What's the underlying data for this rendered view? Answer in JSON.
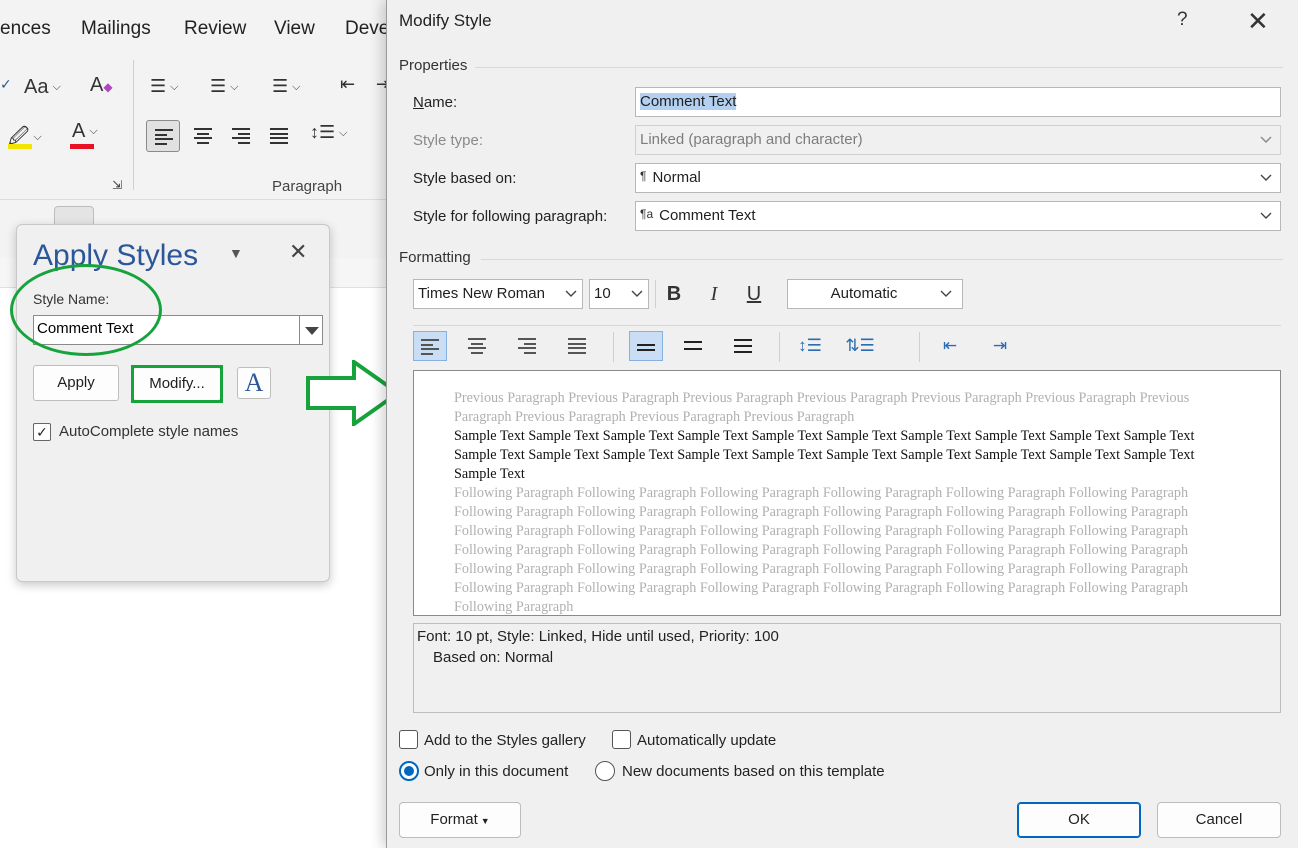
{
  "ribbon": {
    "tabs": [
      "ences",
      "Mailings",
      "Review",
      "View",
      "Deve"
    ],
    "change_case_label": "Aa",
    "font_color_letter": "A",
    "group_paragraph_label": "Paragraph"
  },
  "apply_styles": {
    "title": "Apply Styles",
    "style_name_label": "Style Name:",
    "style_name_value": "Comment Text",
    "apply_label": "Apply",
    "modify_label": "Modify...",
    "styles_icon_glyph": "A",
    "autocomplete_label": "AutoComplete style names",
    "autocomplete_checked": true
  },
  "dialog": {
    "title": "Modify Style",
    "help": "?",
    "close": "✕",
    "properties_label": "Properties",
    "name_label": "Name:",
    "name_value": "Comment Text",
    "style_type_label": "Style type:",
    "style_type_value": "Linked (paragraph and character)",
    "based_on_label": "Style based on:",
    "based_on_value": "Normal",
    "following_label": "Style for following paragraph:",
    "following_value": "Comment Text",
    "formatting_label": "Formatting",
    "font_name": "Times New Roman",
    "font_size": "10",
    "bold": "B",
    "italic": "I",
    "underline": "U",
    "color_value": "Automatic",
    "preview": {
      "previous": "Previous Paragraph Previous Paragraph Previous Paragraph Previous Paragraph Previous Paragraph Previous Paragraph Previous Paragraph Previous Paragraph Previous Paragraph Previous Paragraph",
      "sample": "Sample Text Sample Text Sample Text Sample Text Sample Text Sample Text Sample Text Sample Text Sample Text Sample Text Sample Text Sample Text Sample Text Sample Text Sample Text Sample Text Sample Text Sample Text Sample Text Sample Text Sample Text",
      "following": "Following Paragraph Following Paragraph Following Paragraph Following Paragraph Following Paragraph Following Paragraph Following Paragraph Following Paragraph Following Paragraph Following Paragraph Following Paragraph Following Paragraph Following Paragraph Following Paragraph Following Paragraph Following Paragraph Following Paragraph Following Paragraph Following Paragraph Following Paragraph Following Paragraph Following Paragraph Following Paragraph Following Paragraph Following Paragraph Following Paragraph Following Paragraph Following Paragraph Following Paragraph Following Paragraph Following Paragraph Following Paragraph Following Paragraph Following Paragraph Following Paragraph Following Paragraph Following Paragraph"
    },
    "description_line1": "Font: 10 pt, Style: Linked, Hide until used, Priority: 100",
    "description_line2": "Based on: Normal",
    "add_to_gallery_label": "Add to the Styles gallery",
    "auto_update_label": "Automatically update",
    "only_this_doc_label": "Only in this document",
    "new_docs_label": "New documents based on this template",
    "format_label": "Format",
    "ok_label": "OK",
    "cancel_label": "Cancel"
  },
  "colors": {
    "accent_blue": "#0067c0",
    "annotation_green": "#16a33b",
    "title_blue": "#2b579a"
  }
}
